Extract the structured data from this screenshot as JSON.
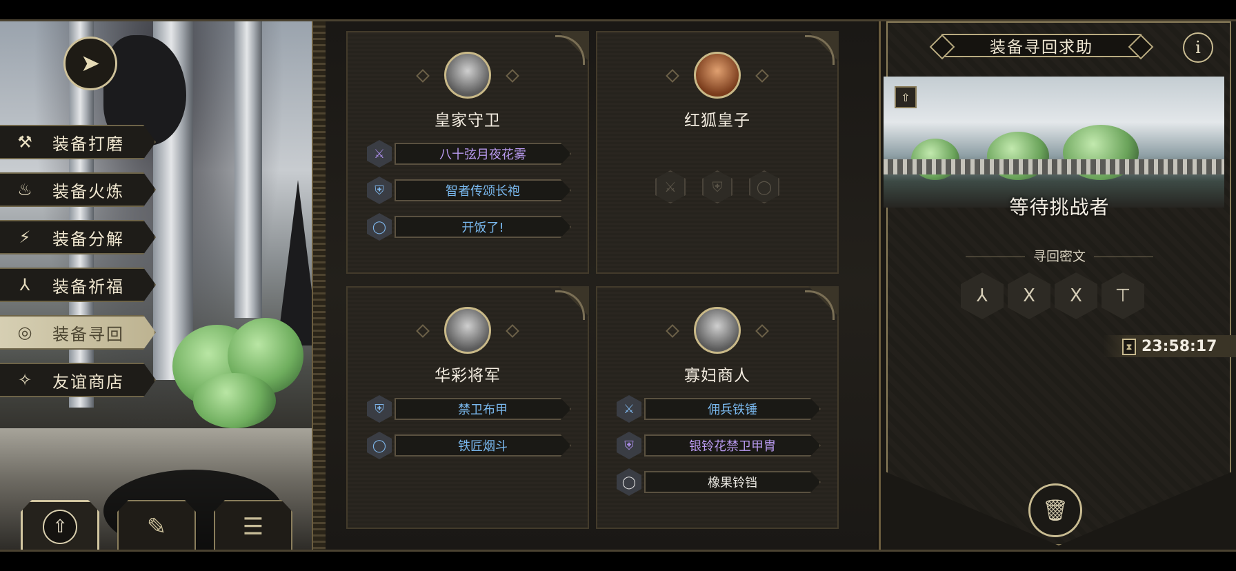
{
  "left_menu": {
    "items": [
      {
        "label": "装备打磨",
        "icon": "hammer-icon",
        "glyph": "⚒",
        "active": false
      },
      {
        "label": "装备火炼",
        "icon": "flame-icon",
        "glyph": "♨",
        "active": false
      },
      {
        "label": "装备分解",
        "icon": "lightning-circle-icon",
        "glyph": "⚡",
        "active": false
      },
      {
        "label": "装备祈福",
        "icon": "praying-hands-icon",
        "glyph": "⅄",
        "active": false
      },
      {
        "label": "装备寻回",
        "icon": "target-icon",
        "glyph": "◎",
        "active": true
      },
      {
        "label": "友谊商店",
        "icon": "fox-head-icon",
        "glyph": "✧",
        "active": false
      }
    ]
  },
  "bottom_tabs": [
    {
      "icon": "upload-doc-icon",
      "glyph": "⇧",
      "active": true
    },
    {
      "icon": "feather-icon",
      "glyph": "✎",
      "active": false
    },
    {
      "icon": "list-icon",
      "glyph": "☰",
      "active": false
    }
  ],
  "npcs": [
    {
      "name": "皇家守卫",
      "portrait": "knight-portrait",
      "slots": [
        {
          "item": "八十弦月夜花雾",
          "icon": "sword-icon",
          "glyph": "⚔",
          "rarity": "purple"
        },
        {
          "item": "智者传颂长袍",
          "icon": "armor-icon",
          "glyph": "⛨",
          "rarity": "blue"
        },
        {
          "item": "开饭了!",
          "icon": "ring-icon",
          "glyph": "◯",
          "rarity": "blue"
        }
      ]
    },
    {
      "name": "红狐皇子",
      "portrait": "fox-portrait",
      "slots": [],
      "empty": [
        {
          "icon": "sword-icon",
          "glyph": "⚔"
        },
        {
          "icon": "armor-icon",
          "glyph": "⛨"
        },
        {
          "icon": "ring-icon",
          "glyph": "◯"
        }
      ]
    },
    {
      "name": "华彩将军",
      "portrait": "general-portrait",
      "slots": [
        {
          "item": "禁卫布甲",
          "icon": "armor-icon",
          "glyph": "⛨",
          "rarity": "blue"
        },
        {
          "item": "铁匠烟斗",
          "icon": "ring-icon",
          "glyph": "◯",
          "rarity": "blue"
        }
      ]
    },
    {
      "name": "寡妇商人",
      "portrait": "merchant-portrait",
      "slots": [
        {
          "item": "佣兵铁锤",
          "icon": "sword-icon",
          "glyph": "⚔",
          "rarity": "blue"
        },
        {
          "item": "银铃花禁卫甲胄",
          "icon": "armor-icon",
          "glyph": "⛨",
          "rarity": "purple"
        },
        {
          "item": "橡果铃铛",
          "icon": "ring-icon",
          "glyph": "◯",
          "rarity": "white"
        }
      ]
    }
  ],
  "right_panel": {
    "title": "装备寻回求助",
    "info_glyph": "i",
    "status": "等待挑战者",
    "cipher_label": "寻回密文",
    "runes": [
      "⅄",
      "ꓫ",
      "ꓫ",
      "⊤"
    ],
    "timer": "23:58:17",
    "up_glyph": "⇧",
    "trash_glyph": "🗑"
  }
}
